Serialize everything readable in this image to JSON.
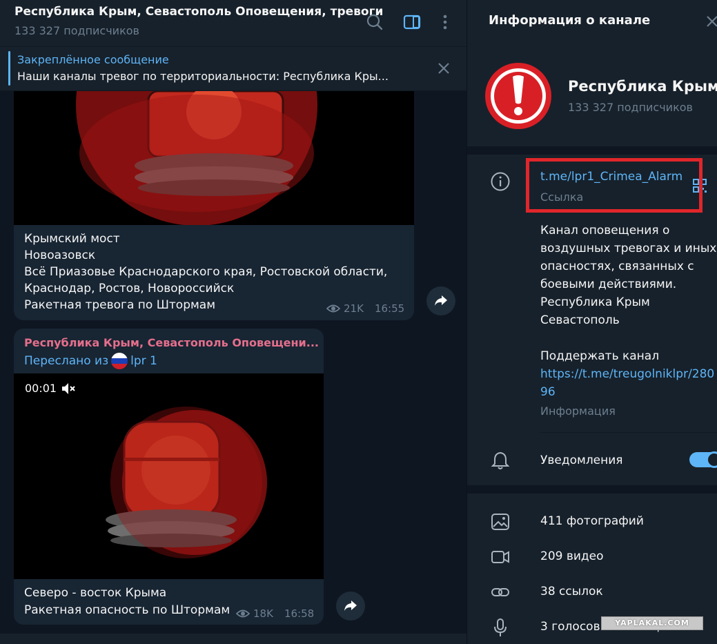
{
  "chat": {
    "title": "Республика Крым, Севастополь Оповещения, тревоги",
    "subscribers": "133 327 подписчиков",
    "pinned": {
      "title": "Закреплённое сообщение",
      "text": "Наши каналы тревог по территориальности:  Республика Кры..."
    },
    "messages": [
      {
        "caption_lines": [
          "Крымский мост",
          "Новоазовск",
          "Всё Приазовье Краснодарского края, Ростовской области,",
          "Краснодар, Ростов, Новороссийск",
          "Ракетная тревога по Штормам"
        ],
        "views": "21K",
        "time": "16:55"
      },
      {
        "from": "Республика Крым, Севастополь Оповещени...",
        "forwarded_prefix": "Переслано из",
        "forwarded_source": "lpr 1",
        "video_time": "00:01",
        "caption_lines": [
          "Северо - восток Крыма",
          "Ракетная опасность по Штормам"
        ],
        "views": "18K",
        "time": "16:58"
      }
    ]
  },
  "info": {
    "title": "Информация о канале",
    "channel_name": "Республика Крым...",
    "subscribers": "133 327 подписчиков",
    "link": "t.me/lpr1_Crimea_Alarm",
    "link_label": "Ссылка",
    "description_lines": [
      "Канал оповещения о",
      "воздушных тревогах и иных",
      "опасностях, связанных с",
      "боевыми действиями.",
      "Республика Крым",
      "Севастополь"
    ],
    "support_text": "Поддержать канал",
    "support_link": "https://t.me/treugolniklpr/28096",
    "description_label": "Информация",
    "notifications_label": "Уведомления",
    "notifications_on": true,
    "media": {
      "photos": "411 фотографий",
      "videos": "209 видео",
      "links": "38 ссылок",
      "voice": "3 голосовых сообщения"
    }
  },
  "watermark": "YAPLAKAL.COM",
  "colors": {
    "accent": "#5eb5f7",
    "sender_name": "#e56f8c",
    "highlight_box": "#e0262b",
    "bubble": "#182533"
  }
}
